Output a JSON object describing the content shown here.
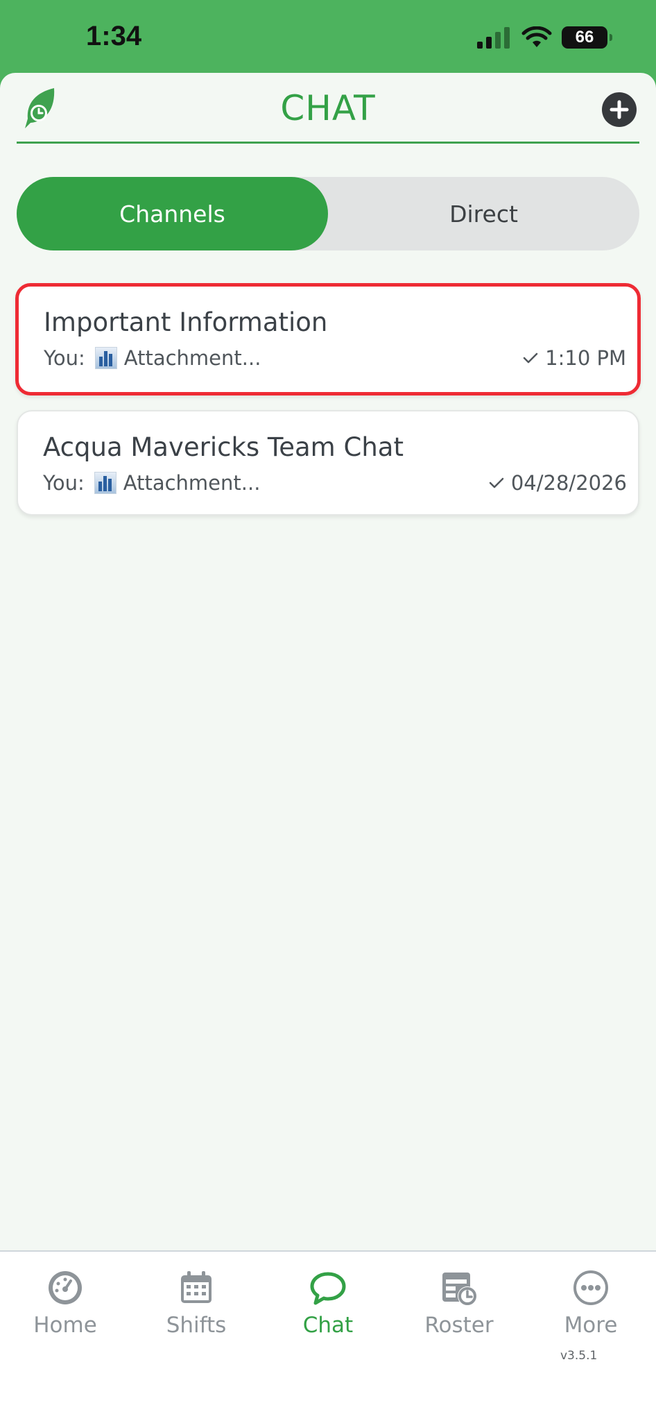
{
  "status_bar": {
    "time": "1:34",
    "battery": "66"
  },
  "header": {
    "title": "CHAT"
  },
  "segment": {
    "channels": "Channels",
    "direct": "Direct"
  },
  "chats": [
    {
      "name": "Important Information",
      "sender": "You:",
      "preview": "Attachment...",
      "time": "1:10 PM"
    },
    {
      "name": "Acqua Mavericks Team Chat",
      "sender": "You:",
      "preview": "Attachment...",
      "time": "04/28/2026"
    }
  ],
  "nav": {
    "home": "Home",
    "shifts": "Shifts",
    "chat": "Chat",
    "roster": "Roster",
    "more": "More",
    "version": "v3.5.1"
  },
  "colors": {
    "brand_green": "#33a146",
    "status_green": "#4db35e",
    "highlight_red": "#ee2b34"
  }
}
